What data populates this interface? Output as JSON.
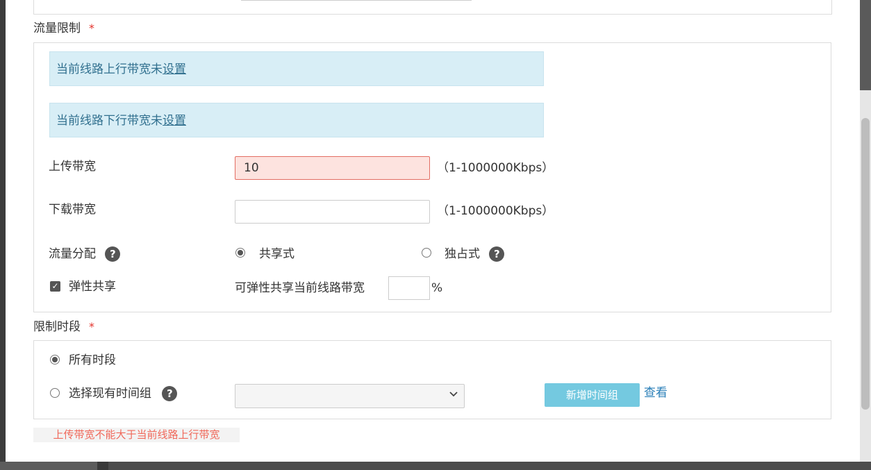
{
  "traffic_limit": {
    "section_label": "流量限制",
    "required_mark": "*",
    "uplink_notice": {
      "text": "当前线路上行带宽未",
      "link": "设置"
    },
    "downlink_notice": {
      "text": "当前线路下行带宽未",
      "link": "设置"
    },
    "upload": {
      "label": "上传带宽",
      "value": "10",
      "hint": "（1-1000000Kbps）"
    },
    "download": {
      "label": "下载带宽",
      "value": "",
      "hint": "（1-1000000Kbps）"
    },
    "allocation": {
      "label": "流量分配",
      "help_glyph": "?",
      "options": [
        {
          "label": "共享式",
          "checked": true
        },
        {
          "label": "独占式",
          "checked": false
        }
      ]
    },
    "elastic": {
      "label": "弹性共享",
      "checked": true,
      "check_glyph": "✓",
      "desc": "可弹性共享当前线路带宽",
      "value": "",
      "unit": "%"
    }
  },
  "time_limit": {
    "section_label": "限制时段",
    "required_mark": "*",
    "options": [
      {
        "label": "所有时段",
        "checked": true
      },
      {
        "label": "选择现有时间组",
        "checked": false
      }
    ],
    "help_glyph": "?",
    "select_value": "",
    "add_button": "新增时间组",
    "view_link": "查看"
  },
  "error_message": "上传带宽不能大于当前线路上行带宽",
  "colors": {
    "info_bg": "#d8eef6",
    "info_text": "#31708f",
    "error_input_bg": "#fde3df",
    "error_text": "#f0685a",
    "required": "#e3332c",
    "button": "#74c9e0"
  }
}
